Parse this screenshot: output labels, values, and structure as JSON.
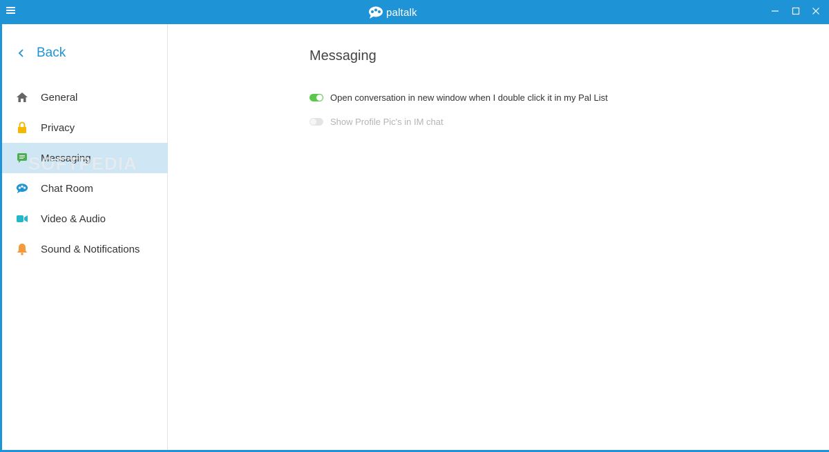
{
  "titlebar": {
    "brand": "paltalk",
    "menu_icon": "hamburger-menu-icon",
    "minimize_icon": "minimize-icon",
    "maximize_icon": "maximize-icon",
    "close_icon": "close-icon",
    "color": "#1e94d6"
  },
  "sidebar": {
    "back_label": "Back",
    "items": [
      {
        "label": "General",
        "icon": "home-icon",
        "icon_color": "#666666",
        "active": false
      },
      {
        "label": "Privacy",
        "icon": "lock-icon",
        "icon_color": "#f5b800",
        "active": false
      },
      {
        "label": "Messaging",
        "icon": "message-icon",
        "icon_color": "#4caf50",
        "active": true
      },
      {
        "label": "Chat Room",
        "icon": "chat-room-icon",
        "icon_color": "#1e94d6",
        "active": false
      },
      {
        "label": "Video & Audio",
        "icon": "video-camera-icon",
        "icon_color": "#26b6c9",
        "active": false
      },
      {
        "label": "Sound & Notifications",
        "icon": "bell-icon",
        "icon_color": "#f39c3d",
        "active": false
      }
    ],
    "active_bg": "#cfe6f5"
  },
  "watermark": "SOFTPEDIA",
  "main": {
    "title": "Messaging",
    "settings": [
      {
        "label": "Open conversation in new window when I double click it in my Pal List",
        "enabled": true,
        "on": true
      },
      {
        "label": "Show Profile Pic's in IM chat",
        "enabled": false,
        "on": false
      }
    ],
    "toggle_on_color": "#5cc84b"
  }
}
